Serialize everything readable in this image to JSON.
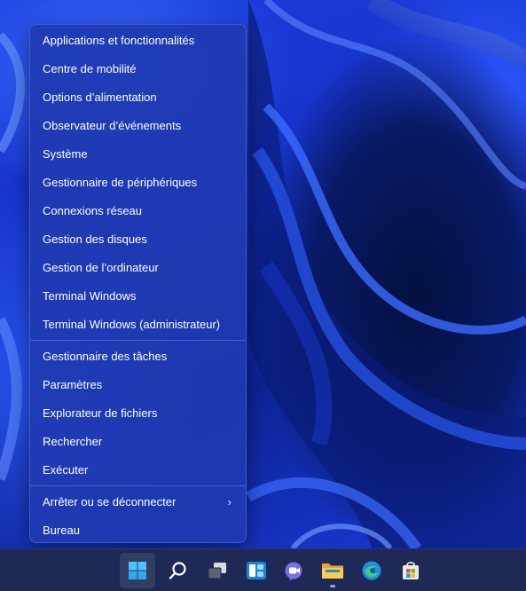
{
  "menu": {
    "group1": [
      {
        "id": "apps",
        "label": "Applications et fonctionnalités"
      },
      {
        "id": "mobility",
        "label": "Centre de mobilité"
      },
      {
        "id": "power",
        "label": "Options d’alimentation"
      },
      {
        "id": "event-viewer",
        "label": "Observateur d’événements"
      },
      {
        "id": "system",
        "label": "Système"
      },
      {
        "id": "device-manager",
        "label": "Gestionnaire de périphériques"
      },
      {
        "id": "network",
        "label": "Connexions réseau"
      },
      {
        "id": "disk",
        "label": "Gestion des disques"
      },
      {
        "id": "computer-mgmt",
        "label": "Gestion de l’ordinateur"
      },
      {
        "id": "terminal",
        "label": "Terminal Windows"
      },
      {
        "id": "terminal-admin",
        "label": "Terminal Windows (administrateur)"
      }
    ],
    "group2": [
      {
        "id": "task-manager",
        "label": "Gestionnaire des tâches"
      },
      {
        "id": "settings",
        "label": "Paramètres"
      },
      {
        "id": "explorer",
        "label": "Explorateur de fichiers"
      },
      {
        "id": "search",
        "label": "Rechercher"
      },
      {
        "id": "run",
        "label": "Exécuter"
      }
    ],
    "group3": [
      {
        "id": "shutdown",
        "label": "Arrêter ou se déconnecter",
        "arrow": "›"
      },
      {
        "id": "desktop",
        "label": "Bureau"
      }
    ]
  },
  "taskbar": {
    "icons": [
      "start-icon",
      "search-icon",
      "task-view-icon",
      "widgets-icon",
      "teams-chat-icon",
      "file-explorer-icon",
      "edge-icon",
      "store-icon"
    ]
  },
  "colors": {
    "menu_bg": "#1e3ab2",
    "taskbar_bg": "#1e2a55",
    "start_blue": "#4cc2ff"
  }
}
